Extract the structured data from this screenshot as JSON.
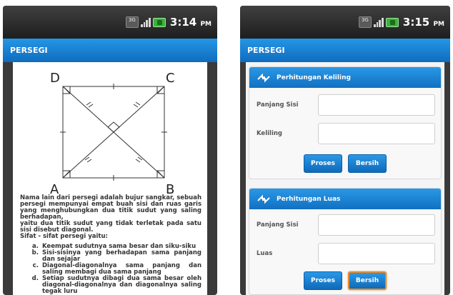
{
  "left_screen": {
    "status_bar": {
      "network": "3G",
      "time": "3:14",
      "ampm": "PM"
    },
    "title": "PERSEGI",
    "diagram": {
      "vertices": {
        "top_left": "D",
        "top_right": "C",
        "bottom_left": "A",
        "bottom_right": "B"
      }
    },
    "description": {
      "paragraph1": "Nama lain dari persegi adalah bujur sangkar, sebuah persegi mempunyai empat buah sisi dan ruas garis yang menghubungkan dua titik sudut yang saling berhadapan,",
      "paragraph2": "yaitu dua titik sudut yang tidak terletak pada satu sisi disebut diagonal.",
      "properties_title": "Sifat - sifat persegi yaitu:",
      "properties": [
        {
          "marker": "a.",
          "text": "Keempat sudutnya sama besar dan siku-siku"
        },
        {
          "marker": "b.",
          "text": "Sisi-sisinya yang berhadapan sama panjang dan sejajar"
        },
        {
          "marker": "c.",
          "text": "Diagonal-diagonalnya sama panjang dan saling membagi dua sama panjang"
        },
        {
          "marker": "d.",
          "text": "Setiap sudutnya dibagi dua sama besar oleh diagonal-diagonalnya dan diagonalnya saling tegak luru"
        }
      ]
    }
  },
  "right_screen": {
    "status_bar": {
      "network": "3G",
      "time": "3:15",
      "ampm": "PM"
    },
    "title": "PERSEGI",
    "keliling_section": {
      "header": "Perhitungan Keliling",
      "side_label": "Panjang Sisi",
      "side_value": "",
      "result_label": "Keliling",
      "result_value": "",
      "process_button": "Proses",
      "clear_button": "Bersih"
    },
    "luas_section": {
      "header": "Perhitungan Luas",
      "side_label": "Panjang Sisi",
      "side_value": "",
      "result_label": "Luas",
      "result_value": "",
      "process_button": "Proses",
      "clear_button": "Bersih"
    }
  },
  "icons": {
    "section_icon": "calculator-arrows-icon"
  },
  "colors": {
    "accent_blue": "#1a82d6",
    "focus_orange": "#e88a2a",
    "battery_green": "#3bb33b"
  }
}
